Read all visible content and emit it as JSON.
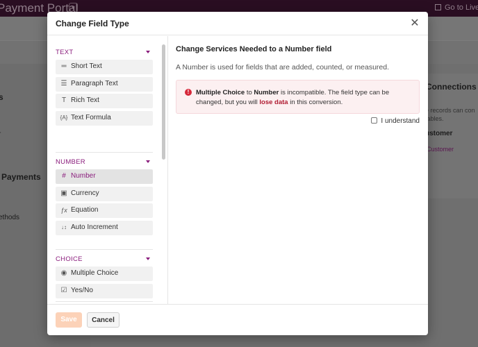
{
  "background": {
    "app_title": "Payment Portal",
    "go_live": "Go to Live",
    "left_items": [
      "s",
      "r",
      "Payments",
      "ethods"
    ],
    "right_items": [
      "Connections",
      "e records can con",
      "tables.",
      "ustomer",
      "Customer"
    ]
  },
  "modal": {
    "title": "Change Field Type",
    "sections": [
      {
        "label": "TEXT",
        "items": [
          {
            "label": "Short Text",
            "icon": "short-text-icon",
            "glyph": "═"
          },
          {
            "label": "Paragraph Text",
            "icon": "paragraph-text-icon",
            "glyph": "☰"
          },
          {
            "label": "Rich Text",
            "icon": "rich-text-icon",
            "glyph": "T"
          },
          {
            "label": "Text Formula",
            "icon": "text-formula-icon",
            "glyph": "{A}"
          }
        ]
      },
      {
        "label": "NUMBER",
        "items": [
          {
            "label": "Number",
            "icon": "number-icon",
            "glyph": "#",
            "active": true
          },
          {
            "label": "Currency",
            "icon": "currency-icon",
            "glyph": "▣"
          },
          {
            "label": "Equation",
            "icon": "equation-icon",
            "glyph": "ƒx"
          },
          {
            "label": "Auto Increment",
            "icon": "auto-increment-icon",
            "glyph": "↓↕"
          }
        ]
      },
      {
        "label": "CHOICE",
        "items": [
          {
            "label": "Multiple Choice",
            "icon": "multiple-choice-icon",
            "glyph": "◉"
          },
          {
            "label": "Yes/No",
            "icon": "yes-no-icon",
            "glyph": "☑"
          }
        ]
      }
    ],
    "content": {
      "title": "Change Services Needed to a Number field",
      "description": "A Number is used for fields that are added, counted, or measured.",
      "alert": {
        "from_type": "Multiple Choice",
        "to_word": "to",
        "to_type": "Number",
        "message_part1": "is incompatible. The field type can be changed, but you will",
        "danger": "lose data",
        "message_part2": "in this conversion."
      },
      "understand_label": "I understand"
    },
    "footer": {
      "save_label": "Save",
      "cancel_label": "Cancel"
    }
  },
  "colors": {
    "accent": "#8a1c7c",
    "danger": "#d6283a",
    "save_disabled": "#fcd2b8"
  }
}
